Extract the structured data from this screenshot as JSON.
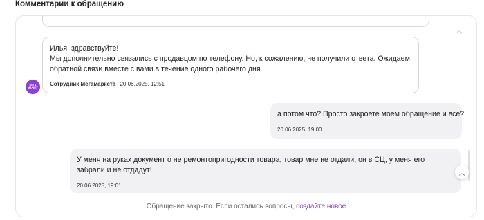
{
  "section": {
    "title": "Комментарии к обращению"
  },
  "thread": {
    "support_message": {
      "text": "Илья, здравствуйте!\nМы дополнительно связались с продавцом по телефону. Но, к сожалению, не получили ответа. Ожидаем обратной связи вместе с вами в течение одного рабочего дня.",
      "sender": "Сотрудник Мегамаркета",
      "time": "20.06.2025, 12:51",
      "avatar_label": "МЕГА МАРКЕТ",
      "avatar_color": "#8d3fd6"
    },
    "user_message_1": {
      "text": "а потом что? Просто закроете моем обращение и все?",
      "time": "20.06.2025, 19:00"
    },
    "user_message_2": {
      "text": "У меня на руках документ о не ремонтопригодности товара, товар мне не отдали, он в СЦ, у меня его забрали и не отдадут!",
      "time": "20.06.2025, 19:01"
    }
  },
  "footer": {
    "closed_text": "Обращение закрыто. Если остались вопросы,",
    "create_link": "создайте новое",
    "link_color": "#7b3fd0"
  },
  "icons": {
    "scroll_up": "chevron-up-icon"
  }
}
